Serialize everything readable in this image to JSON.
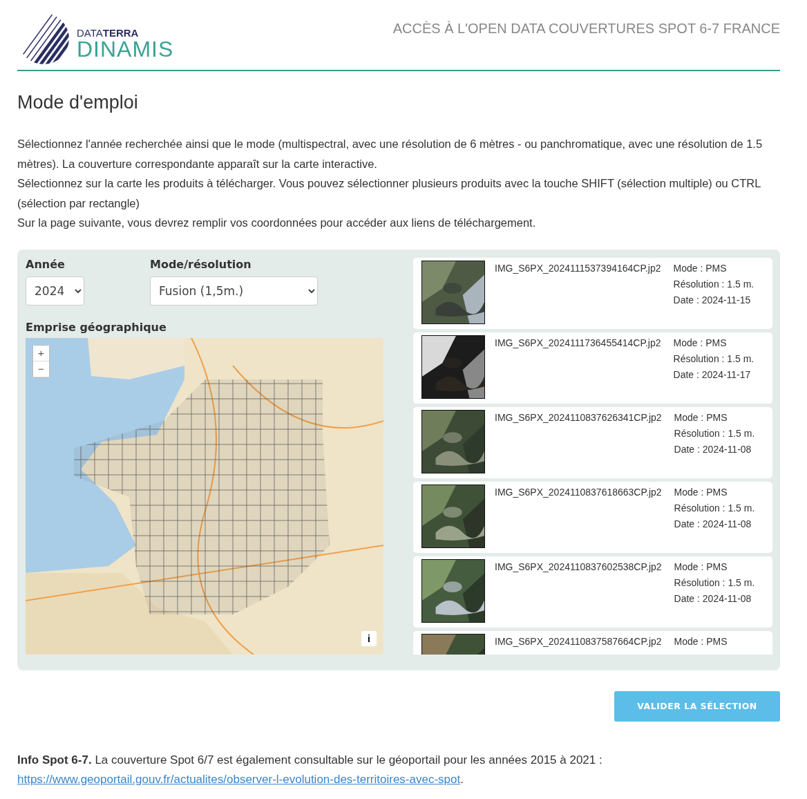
{
  "header": {
    "logo_top": "DATA**TERRA**",
    "logo_main": "DINAMIS",
    "title": "ACCÈS À L'OPEN DATA COUVERTURES SPOT 6-7 FRANCE"
  },
  "heading": "Mode d'emploi",
  "instructions": [
    "Sélectionnez l'année recherchée ainsi que le mode (multispectral, avec une résolution de 6 mètres - ou panchromatique, avec une résolution de 1.5 mètres). La couverture correspondante apparaît sur la carte interactive.",
    "Sélectionnez sur la carte les produits à télécharger. Vous pouvez sélectionner plusieurs produits avec la touche SHIFT (sélection multiple) ou CTRL (sélection par rectangle)",
    "Sur la page suivante, vous devrez remplir vos coordonnées pour accéder aux liens de téléchargement."
  ],
  "filters": {
    "year": {
      "label": "Année",
      "value": "2024"
    },
    "mode": {
      "label": "Mode/résolution",
      "value": "Fusion (1,5m.)"
    }
  },
  "map": {
    "label": "Emprise géographique",
    "zoom_in": "+",
    "zoom_out": "−",
    "info": "i"
  },
  "products": [
    {
      "name": "IMG_S6PX_2024111537394164CP.jp2",
      "mode": "Mode : PMS",
      "resolution": "Résolution : 1.5 m.",
      "date": "Date : 2024-11-15"
    },
    {
      "name": "IMG_S6PX_2024111736455414CP.jp2",
      "mode": "Mode : PMS",
      "resolution": "Résolution : 1.5 m.",
      "date": "Date : 2024-11-17"
    },
    {
      "name": "IMG_S6PX_2024110837626341CP.jp2",
      "mode": "Mode : PMS",
      "resolution": "Résolution : 1.5 m.",
      "date": "Date : 2024-11-08"
    },
    {
      "name": "IMG_S6PX_2024110837618663CP.jp2",
      "mode": "Mode : PMS",
      "resolution": "Résolution : 1.5 m.",
      "date": "Date : 2024-11-08"
    },
    {
      "name": "IMG_S6PX_2024110837602538CP.jp2",
      "mode": "Mode : PMS",
      "resolution": "Résolution : 1.5 m.",
      "date": "Date : 2024-11-08"
    },
    {
      "name": "IMG_S6PX_2024110837587664CP.jp2",
      "mode": "Mode : PMS"
    }
  ],
  "submit_button": "VALIDER LA SÉLECTION",
  "footer": {
    "text": "**Info Spot 6-7.** La couverture Spot 6/7 est également consultable sur le géoportail pour les années 2015 à 2021 :",
    "link": "https://www.geoportail.gouv.fr/actualites/observer-l-evolution-des-territoires-avec-spot",
    "after": "."
  }
}
